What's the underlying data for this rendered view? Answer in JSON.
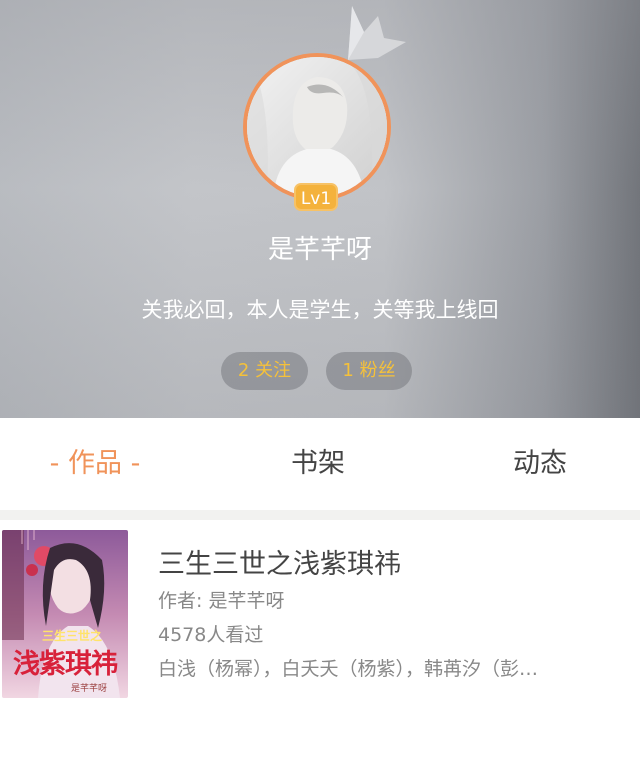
{
  "profile": {
    "level": "Lv1",
    "username": "是芊芊呀",
    "bio": "关我必回，本人是学生，关等我上线回",
    "following": "2 关注",
    "followers": "1 粉丝",
    "accent_color": "#f0935a",
    "badge_color": "#f4b23c",
    "stat_color": "#f5c13a"
  },
  "tabs": {
    "works": "- 作品 -",
    "bookshelf": "书架",
    "feed": "动态"
  },
  "works": [
    {
      "cover_subtitle": "三生三世之",
      "cover_title": "浅紫琪祎",
      "cover_author": "是芊芊呀",
      "title": "三生三世之浅紫琪祎",
      "author": "作者: 是芊芊呀",
      "views": "4578人看过",
      "description": "白浅（杨幂），白夭夭（杨紫），韩苒汐（彭…"
    }
  ]
}
